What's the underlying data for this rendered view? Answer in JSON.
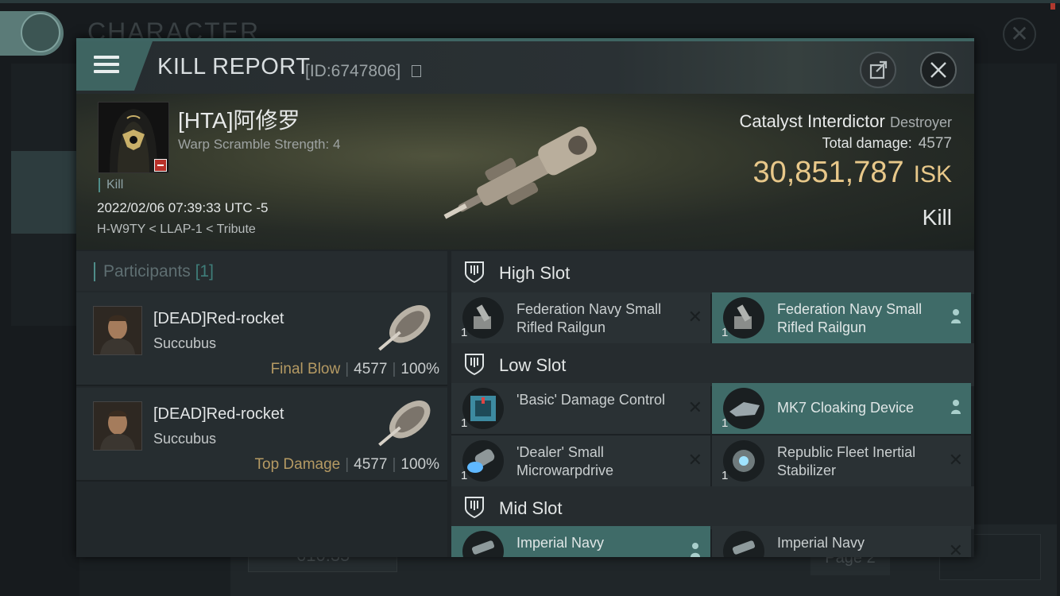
{
  "background": {
    "title": "CHARACTER",
    "price": "610.35",
    "page": "Page 2"
  },
  "window": {
    "title": "KILL REPORT",
    "id": "[ID:6747806]"
  },
  "victim": {
    "name": "[HTA]阿修罗",
    "warp": "Warp Scramble Strength: 4",
    "tag": "Kill",
    "datetime": "2022/02/06 07:39:33 UTC -5",
    "location": "H-W9TY < LLAP-1 < Tribute",
    "ship": "Catalyst Interdictor",
    "ship_class": "Destroyer",
    "total_damage_label": "Total damage:",
    "total_damage": "4577",
    "isk_value": "30,851,787",
    "isk_unit": "ISK",
    "result": "Kill"
  },
  "participants": {
    "label": "Participants",
    "count": "[1]",
    "rows": [
      {
        "name": "[DEAD]Red-rocket",
        "ship": "Succubus",
        "tag": "Final Blow",
        "damage": "4577",
        "percent": "100%"
      },
      {
        "name": "[DEAD]Red-rocket",
        "ship": "Succubus",
        "tag": "Top Damage",
        "damage": "4577",
        "percent": "100%"
      }
    ]
  },
  "slots": {
    "high": {
      "label": "High Slot",
      "items": [
        {
          "name": "Federation Navy Small Rifled Railgun",
          "qty": "1"
        },
        {
          "name": "Federation Navy Small Rifled Railgun",
          "qty": "1"
        }
      ]
    },
    "low": {
      "label": "Low Slot",
      "items": [
        {
          "name": "'Basic' Damage Control",
          "qty": "1"
        },
        {
          "name": "MK7 Cloaking Device",
          "qty": "1"
        },
        {
          "name": "'Dealer' Small Microwarpdrive",
          "qty": "1"
        },
        {
          "name": "Republic Fleet Inertial Stabilizer",
          "qty": "1"
        }
      ]
    },
    "mid": {
      "label": "Mid Slot",
      "items": [
        {
          "name": "Imperial Navy",
          "qty": ""
        },
        {
          "name": "Imperial Navy",
          "qty": ""
        }
      ]
    }
  },
  "colors": {
    "accent": "#3f6b68",
    "isk": "#e8c88a",
    "final_blow": "#b59a63",
    "status_red": "#b8312a"
  }
}
